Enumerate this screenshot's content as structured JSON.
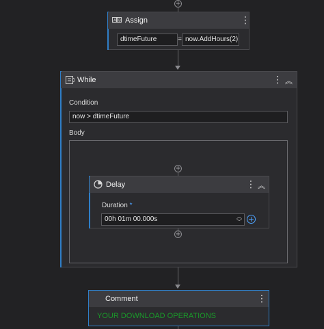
{
  "assign": {
    "title": "Assign",
    "icon": "assign-icon",
    "left_value": "dtimeFuture",
    "operator": "=",
    "right_value": "now.AddHours(2)"
  },
  "while": {
    "title": "While",
    "icon": "while-loop-icon",
    "condition_label": "Condition",
    "condition_value": "now > dtimeFuture",
    "body_label": "Body"
  },
  "delay": {
    "title": "Delay",
    "icon": "delay-clock-icon",
    "duration_label": "Duration",
    "required_marker": "*",
    "duration_value": "00h 01m 00.000s"
  },
  "comment": {
    "title": "Comment",
    "text": "YOUR DOWNLOAD OPERATIONS"
  },
  "colors": {
    "accent": "#2f7fc8",
    "comment_text": "#1a9a2a",
    "required": "#4da3ff"
  }
}
